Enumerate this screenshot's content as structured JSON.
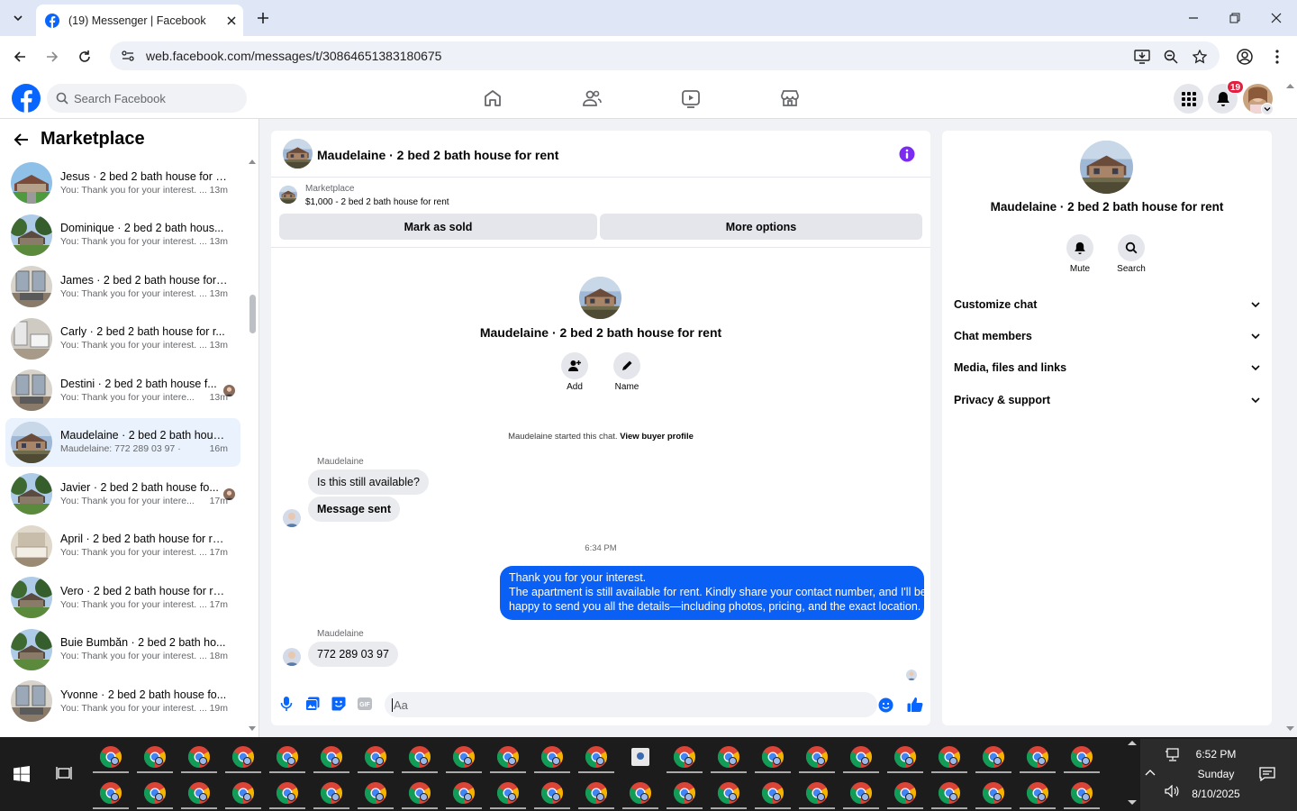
{
  "browser": {
    "tab_title": "(19) Messenger | Facebook",
    "url": "web.facebook.com/messages/t/30864651383180675"
  },
  "fb": {
    "search_placeholder": "Search Facebook",
    "notification_count": "19",
    "nav_icons": [
      "home-icon",
      "friends-icon",
      "watch-icon",
      "marketplace-icon"
    ]
  },
  "sidebar": {
    "title": "Marketplace",
    "conversations": [
      {
        "name": "Jesus · 2 bed 2 bath house for r...",
        "snippet": "You: Thank you for your interest. ...",
        "time": "13m",
        "active": false,
        "read": false,
        "img": "house-green"
      },
      {
        "name": "Dominique · 2 bed 2 bath hous...",
        "snippet": "You: Thank you for your interest. ...",
        "time": "13m",
        "active": false,
        "read": false,
        "img": "house-trees"
      },
      {
        "name": "James · 2 bed 2 bath house for ...",
        "snippet": "You: Thank you for your interest. ...",
        "time": "13m",
        "active": false,
        "read": false,
        "img": "room"
      },
      {
        "name": "Carly · 2 bed 2 bath house for r...",
        "snippet": "You: Thank you for your interest. ...",
        "time": "13m",
        "active": false,
        "read": false,
        "img": "bath"
      },
      {
        "name": "Destini · 2 bed 2 bath house f...",
        "snippet": "You: Thank you for your intere...",
        "time": "13m",
        "active": false,
        "read": true,
        "img": "room"
      },
      {
        "name": "Maudelaine · 2 bed 2 bath hous...",
        "snippet": "Maudelaine: 772 289 03 97 ·",
        "time": "16m",
        "active": true,
        "read": false,
        "img": "house-brown"
      },
      {
        "name": "Javier · 2 bed 2 bath house fo...",
        "snippet": "You: Thank you for your intere...",
        "time": "17m",
        "active": false,
        "read": true,
        "img": "house-trees"
      },
      {
        "name": "April · 2 bed 2 bath house for re...",
        "snippet": "You: Thank you for your interest. ...",
        "time": "17m",
        "active": false,
        "read": false,
        "img": "bedroom"
      },
      {
        "name": "Vero · 2 bed 2 bath house for rent",
        "snippet": "You: Thank you for your interest. ...",
        "time": "17m",
        "active": false,
        "read": false,
        "img": "house-trees"
      },
      {
        "name": "Buie Bumbăn · 2 bed 2 bath ho...",
        "snippet": "You: Thank you for your interest. ...",
        "time": "18m",
        "active": false,
        "read": false,
        "img": "house-trees"
      },
      {
        "name": "Yvonne · 2 bed 2 bath house fo...",
        "snippet": "You: Thank you for your interest. ...",
        "time": "19m",
        "active": false,
        "read": false,
        "img": "room"
      }
    ]
  },
  "chat": {
    "header_title": "Maudelaine · 2 bed 2 bath house for rent",
    "listing_source": "Marketplace",
    "listing_price": "$1,000 - 2 bed 2 bath house for rent",
    "mark_sold_label": "Mark as sold",
    "more_options_label": "More options",
    "profile_title": "Maudelaine · 2 bed 2 bath house for rent",
    "add_label": "Add",
    "name_label": "Name",
    "started_text": "Maudelaine started this chat.",
    "view_profile_link": "View buyer profile",
    "sender_name": "Maudelaine",
    "msg1": "Is this still available?",
    "msg2": "Message sent",
    "timestamp": "6:34 PM",
    "outgoing_lines": [
      "Thank you for your interest.",
      "The apartment is still available for rent. Kindly share your contact number, and I'll be",
      "happy to send you all the details—including photos, pricing, and the exact location."
    ],
    "sender_name2": "Maudelaine",
    "msg3": "772 289 03 97",
    "composer_placeholder": "Aa"
  },
  "info": {
    "title": "Maudelaine · 2 bed 2 bath house for rent",
    "mute_label": "Mute",
    "search_label": "Search",
    "rows": [
      "Customize chat",
      "Chat members",
      "Media, files and links",
      "Privacy & support"
    ]
  },
  "taskbar": {
    "time": "6:52 PM",
    "day": "Sunday",
    "date": "8/10/2025"
  },
  "colors": {
    "accent": "#7b2cf0",
    "fb_blue": "#0866ff",
    "outgoing_bubble": "#0a5ff5",
    "badge": "#e41e3f"
  }
}
